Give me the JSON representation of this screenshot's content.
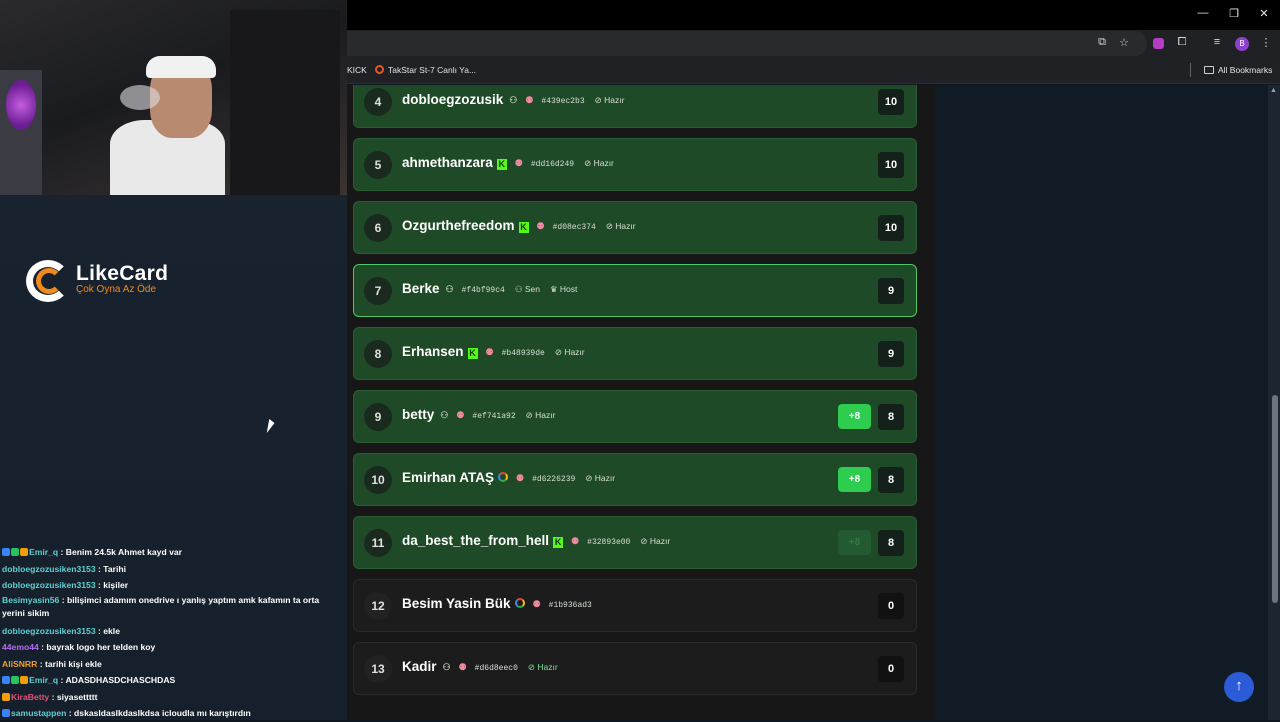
{
  "stream": {
    "logo_title": "LikeCard",
    "logo_subtitle": "Çok Oyna  Az Öde",
    "chat": [
      {
        "user": "Emir_q",
        "message": " : Benim 24.5k Ahmet kayd var",
        "color": "#5fd0d0"
      },
      {
        "user": "dobloegzozusiken3153",
        "message": " : Tarihi",
        "color": "#5fd0d0"
      },
      {
        "user": "dobloegzozusiken3153",
        "message": " : kişiler",
        "color": "#5fd0d0"
      },
      {
        "user": "Besimyasin56",
        "message": " : bilişimci adamım onedrive ı yanlış yaptım amk kafamın ta orta yerini sikim",
        "color": "#5fd0d0"
      },
      {
        "user": "dobloegzozusiken3153",
        "message": " : ekle",
        "color": "#5fd0d0"
      },
      {
        "user": "44emo44",
        "message": " : bayrak logo her telden koy",
        "color": "#b56cf0"
      },
      {
        "user": "AliSNRR",
        "message": " : tarihi kişi ekle",
        "color": "#f0a030"
      },
      {
        "user": "Emir_q",
        "message": " : ADASDHASDCHASCHDAS",
        "color": "#5fd0d0"
      },
      {
        "user": "KiraBetty",
        "message": " : siyasettttt",
        "color": "#e0507a"
      },
      {
        "user": "samustappen",
        "message": " : dskasldaslkdaslkdsa icloudla mı karıştırdın",
        "color": "#5fd0d0"
      }
    ]
  },
  "browser": {
    "window_controls": {
      "minimize": "—",
      "restore": "❐",
      "close": "✕"
    },
    "bookmarks": [
      {
        "label": "KICK"
      },
      {
        "label": "TakStar St-7 Canlı Ya..."
      }
    ],
    "all_bookmarks": "All Bookmarks",
    "profile_initial": "B"
  },
  "leaderboard": {
    "rows": [
      {
        "rank": "4",
        "name": "dobloegzozusik",
        "account": "user",
        "hash": "#439ec2b3",
        "status": "Hazır",
        "score": "10",
        "style": "green"
      },
      {
        "rank": "5",
        "name": "ahmethanzara",
        "account": "kick",
        "hash": "#dd16d249",
        "status": "Hazır",
        "score": "10",
        "style": "green"
      },
      {
        "rank": "6",
        "name": "Ozgurthefreedom",
        "account": "kick",
        "hash": "#d08ec374",
        "status": "Hazır",
        "score": "10",
        "style": "green"
      },
      {
        "rank": "7",
        "name": "Berke",
        "account": "user",
        "hash": "#f4bf99c4",
        "you_label": "Sen",
        "host_label": "Host",
        "score": "9",
        "style": "me"
      },
      {
        "rank": "8",
        "name": "Erhansen",
        "account": "kick",
        "hash": "#b48939de",
        "status": "Hazır",
        "score": "9",
        "style": "green"
      },
      {
        "rank": "9",
        "name": "betty",
        "account": "user",
        "hash": "#ef741a92",
        "status": "Hazır",
        "bonus": "+8",
        "score": "8",
        "style": "green"
      },
      {
        "rank": "10",
        "name": "Emirhan ATAŞ",
        "account": "google",
        "hash": "#d6226239",
        "status": "Hazır",
        "bonus": "+8",
        "score": "8",
        "style": "green"
      },
      {
        "rank": "11",
        "name": "da_best_the_from_hell",
        "account": "kick",
        "hash": "#32893e00",
        "status": "Hazır",
        "bonus": "+8",
        "bonus_faded": true,
        "score": "8",
        "style": "green"
      },
      {
        "rank": "12",
        "name": "Besim Yasin Bük",
        "account": "google",
        "hash": "#1b936ad3",
        "score": "0",
        "style": "plain"
      },
      {
        "rank": "13",
        "name": "Kadir",
        "account": "user",
        "hash": "#d6d8eec0",
        "status": "Hazır",
        "score": "0",
        "style": "plain"
      }
    ]
  },
  "icons": {
    "user": "user-icon",
    "kick": "kick-icon",
    "google": "google-icon",
    "friend": "add-friend-icon",
    "ready": "check-circle-icon",
    "host": "crown-icon"
  },
  "colors": {
    "row_green": "#1f4a27",
    "row_plain": "#1c1c1c",
    "bonus": "#2ecc4f",
    "kick": "#53fc18",
    "fab": "#2b5bd7"
  }
}
